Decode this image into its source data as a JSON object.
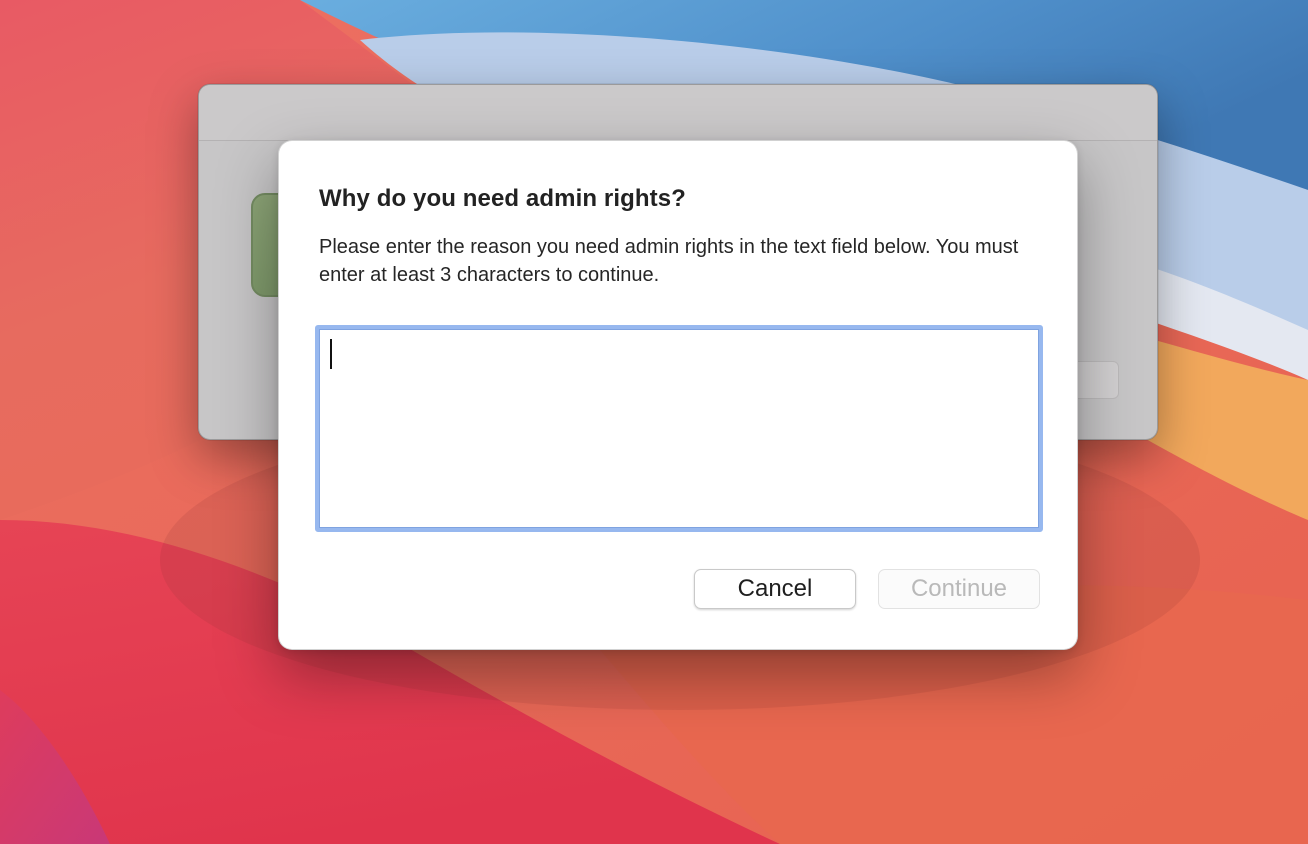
{
  "desktop": {
    "wallpaper_name": "macOS Big Sur",
    "colors": {
      "sky_blue": "#4a8fcf",
      "light_blue": "#b9cfe9",
      "coral": "#e76a58",
      "red": "#e5364b",
      "orange": "#f2a35a",
      "magenta": "#d43a6e"
    }
  },
  "parent_window": {
    "background_color": "#c7c6c7"
  },
  "dialog": {
    "title": "Why do you need admin rights?",
    "message": "Please enter the reason you need admin rights in the text field below. You must enter at least 3 characters to continue.",
    "reason_field": {
      "value": "",
      "focused": true,
      "focus_ring_color": "#97b8ef"
    },
    "buttons": {
      "cancel": {
        "label": "Cancel",
        "enabled": true
      },
      "continue": {
        "label": "Continue",
        "enabled": false
      }
    }
  }
}
